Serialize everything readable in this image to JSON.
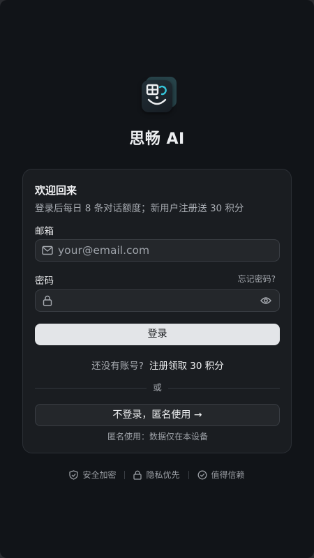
{
  "app": {
    "title": "思畅 AI"
  },
  "card": {
    "welcome": "欢迎回来",
    "subtitle": "登录后每日 8 条对话额度；新用户注册送 30 积分",
    "email": {
      "label": "邮箱",
      "placeholder": "your@email.com",
      "value": ""
    },
    "password": {
      "label": "密码",
      "forgot": "忘记密码?",
      "placeholder": "",
      "value": ""
    },
    "login_button": "登录",
    "register_question": "还没有账号?",
    "register_link": "注册领取 30 积分",
    "divider_text": "或",
    "anon_button": "不登录，匿名使用 →",
    "anon_note": "匿名使用：数据仅在本设备"
  },
  "footer": [
    {
      "label": "安全加密",
      "icon": "shield-icon"
    },
    {
      "label": "隐私优先",
      "icon": "lock-icon"
    },
    {
      "label": "值得信赖",
      "icon": "check-circle-icon"
    }
  ],
  "colors": {
    "background": "#111418",
    "card": "#1a1d21",
    "primary_button": "#e3e5e8",
    "logo_accent": "#35c6dc"
  }
}
